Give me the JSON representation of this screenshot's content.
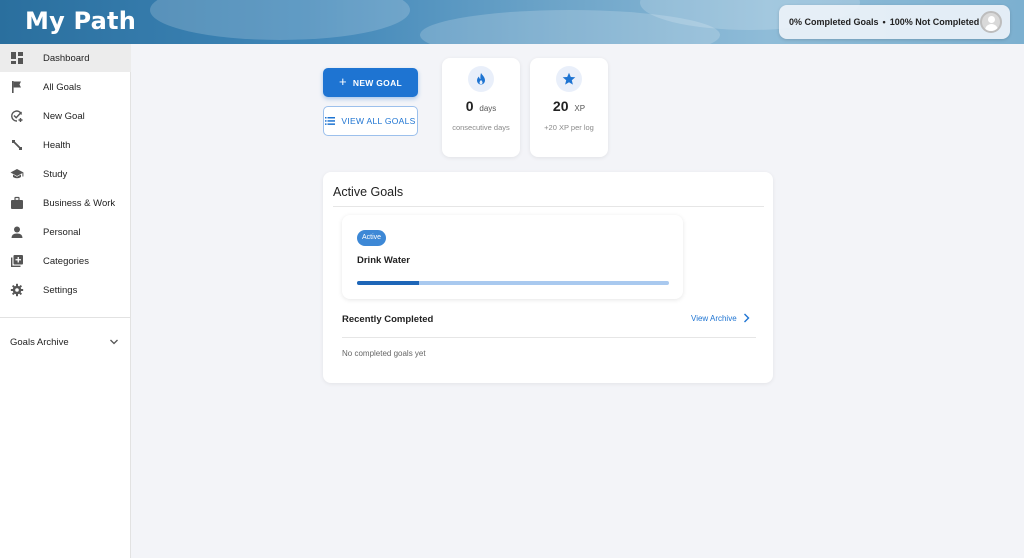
{
  "app": {
    "title": "My Path"
  },
  "header": {
    "stats": {
      "completed": "0% Completed Goals",
      "separator": "•",
      "not_completed": "100% Not Completed"
    },
    "avatar_icon": "user-avatar-icon"
  },
  "sidebar": {
    "items": [
      {
        "label": "Dashboard",
        "icon": "dashboard-icon",
        "active": true
      },
      {
        "label": "All Goals",
        "icon": "flag-icon"
      },
      {
        "label": "New Goal",
        "icon": "add-task-icon"
      },
      {
        "label": "Health",
        "icon": "fitness-icon"
      },
      {
        "label": "Study",
        "icon": "school-icon"
      },
      {
        "label": "Business & Work",
        "icon": "briefcase-icon"
      },
      {
        "label": "Personal",
        "icon": "person-icon"
      },
      {
        "label": "Categories",
        "icon": "library-add-icon"
      },
      {
        "label": "Settings",
        "icon": "gear-icon"
      }
    ],
    "archive": {
      "label": "Goals Archive",
      "icon": "chevron-down-icon"
    }
  },
  "actions": {
    "new_goal": {
      "label": "NEW GOAL",
      "icon": "plus-icon"
    },
    "view_all": {
      "label": "VIEW ALL GOALS",
      "icon": "list-icon"
    }
  },
  "stats": {
    "streak": {
      "value": "0",
      "unit": "days",
      "caption": "consecutive days",
      "icon": "flame-icon"
    },
    "xp": {
      "value": "20",
      "unit": "XP",
      "caption": "+20 XP per log",
      "icon": "star-icon"
    }
  },
  "active_goals": {
    "title": "Active Goals",
    "goals": [
      {
        "badge": "Active",
        "name": "Drink Water",
        "progress": 0.2
      }
    ]
  },
  "recent": {
    "title": "Recently Completed",
    "view_archive": "View Archive",
    "empty": "No completed goals yet"
  },
  "colors": {
    "primary": "#1e74d2",
    "accent_light": "#a9c9ef",
    "background": "#f3f4f8"
  }
}
